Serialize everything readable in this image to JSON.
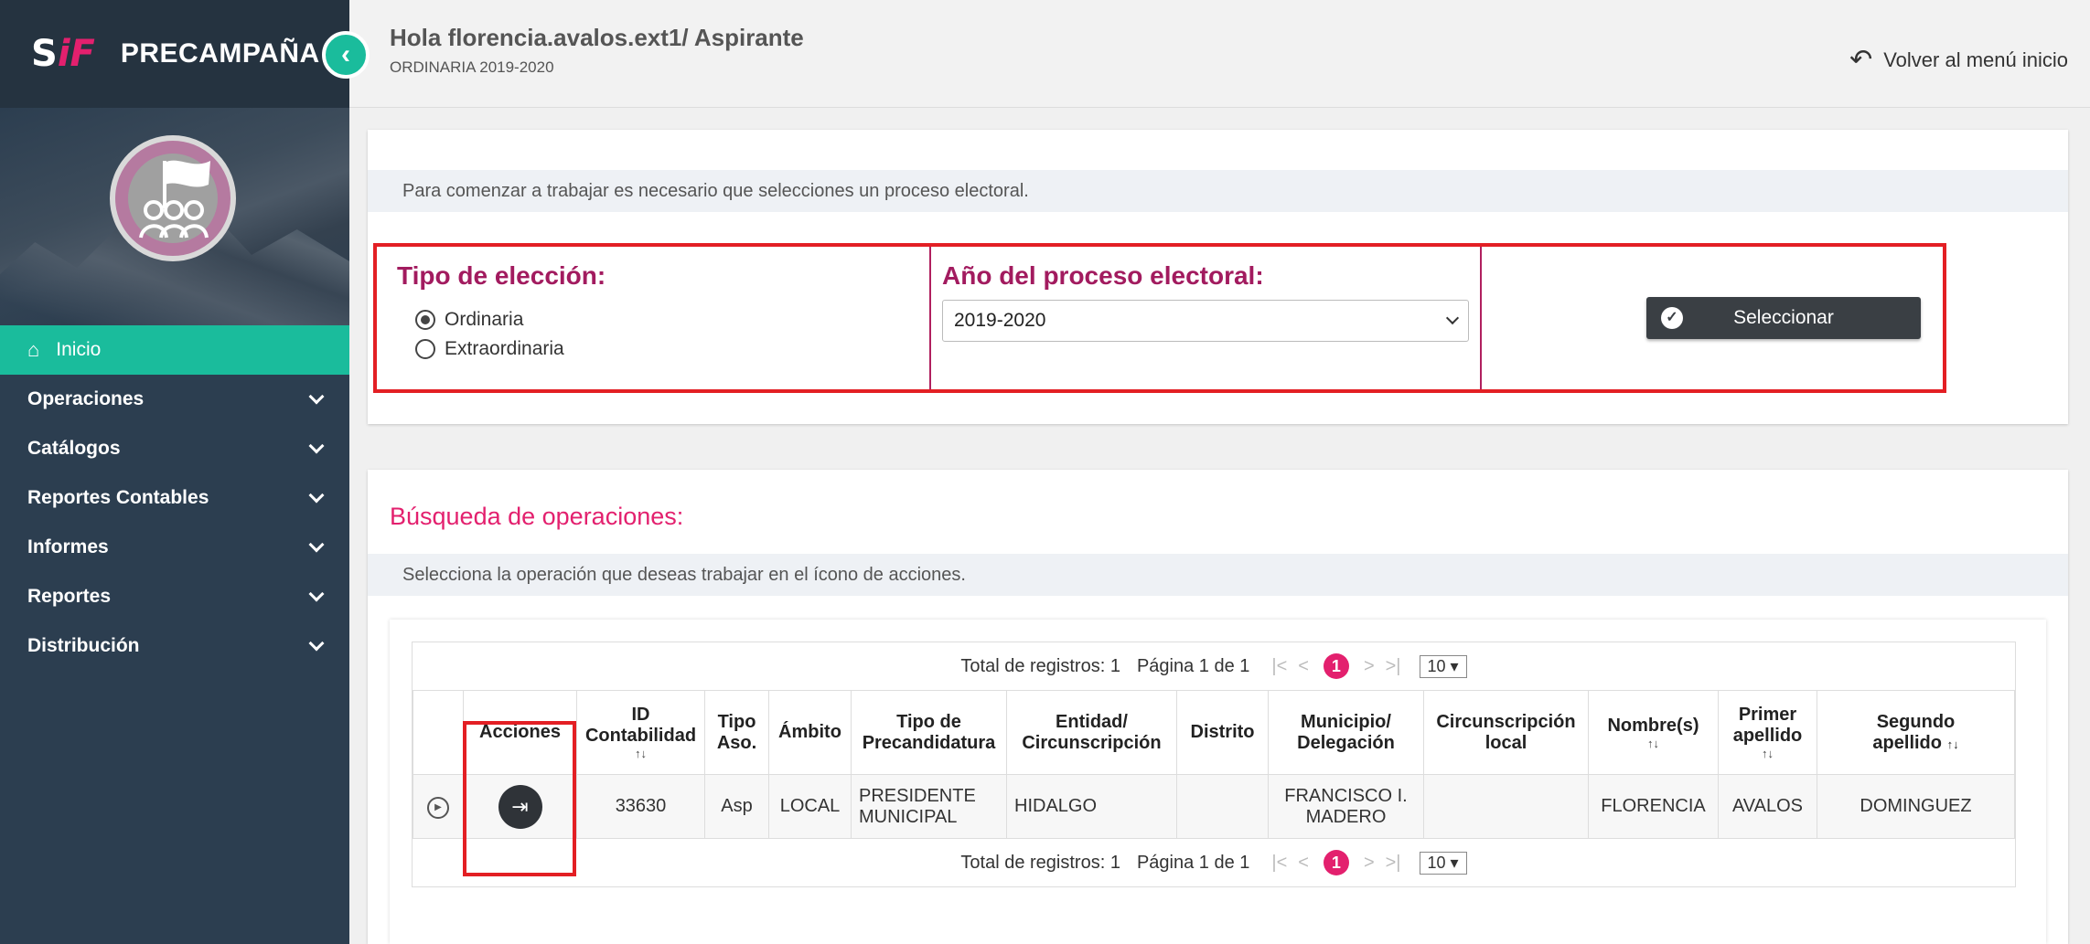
{
  "app": {
    "logo_s": "S",
    "logo_f": "iF",
    "brand": "PRECAMPAÑA"
  },
  "header": {
    "greeting": "Hola florencia.avalos.ext1/ Aspirante",
    "subtitle": "ORDINARIA 2019-2020",
    "back_label": "Volver al menú inicio"
  },
  "sidebar": {
    "items": [
      {
        "label": "Inicio",
        "active": true
      },
      {
        "label": "Operaciones"
      },
      {
        "label": "Catálogos"
      },
      {
        "label": "Reportes Contables"
      },
      {
        "label": "Informes"
      },
      {
        "label": "Reportes"
      },
      {
        "label": "Distribución"
      }
    ]
  },
  "selector": {
    "notice": "Para comenzar a trabajar es necesario que selecciones un proceso electoral.",
    "tipo_label": "Tipo de elección:",
    "options": [
      "Ordinaria",
      "Extraordinaria"
    ],
    "anio_label": "Año del proceso electoral:",
    "anio_value": "2019-2020",
    "button": "Seleccionar"
  },
  "search": {
    "title": "Búsqueda de operaciones:",
    "notice": "Selecciona la operación que deseas trabajar en el ícono de acciones."
  },
  "table": {
    "total": "Total de registros: 1",
    "page": "Página 1 de 1",
    "current_page": "1",
    "page_size": "10",
    "columns": {
      "acciones": "Acciones",
      "id_l1": "ID",
      "id_l2": "Contabilidad",
      "tipo_l1": "Tipo",
      "tipo_l2": "Aso.",
      "ambito": "Ámbito",
      "tipo_pre_l1": "Tipo de",
      "tipo_pre_l2": "Precandidatura",
      "entidad_l1": "Entidad/",
      "entidad_l2": "Circunscripción",
      "distrito": "Distrito",
      "municipio_l1": "Municipio/",
      "municipio_l2": "Delegación",
      "circ_l1": "Circunscripción",
      "circ_l2": "local",
      "nombre": "Nombre(s)",
      "primer_l1": "Primer",
      "primer_l2": "apellido",
      "segundo_l1": "Segundo",
      "segundo_l2": "apellido"
    },
    "row": {
      "id": "33630",
      "tipo": "Asp",
      "ambito": "LOCAL",
      "tipo_pre_l1": "PRESIDENTE",
      "tipo_pre_l2": "MUNICIPAL",
      "entidad": "HIDALGO",
      "distrito": "",
      "municipio_l1": "FRANCISCO I.",
      "municipio_l2": "MADERO",
      "circ": "",
      "nombre": "FLORENCIA",
      "primer": "AVALOS",
      "segundo": "DOMINGUEZ"
    }
  }
}
